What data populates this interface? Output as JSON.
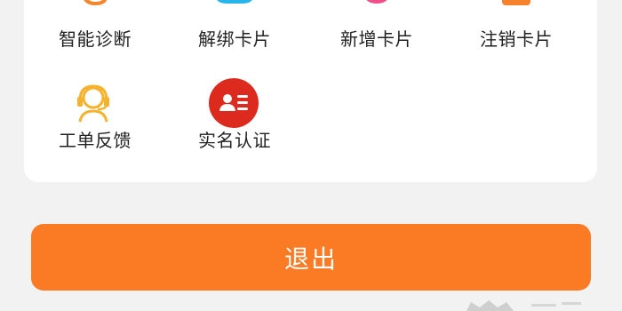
{
  "services": {
    "row1": [
      {
        "label": "智能诊断",
        "icon": "diagnose-icon",
        "color": "#f3862b"
      },
      {
        "label": "解绑卡片",
        "icon": "unbind-card-icon",
        "color": "#2ab4ec"
      },
      {
        "label": "新增卡片",
        "icon": "add-card-icon",
        "color": "#ef4d8a"
      },
      {
        "label": "注销卡片",
        "icon": "cancel-card-icon",
        "color": "#f6822d"
      }
    ],
    "row2": [
      {
        "label": "工单反馈",
        "icon": "customer-service-icon",
        "color": "#f5b22c"
      },
      {
        "label": "实名认证",
        "icon": "id-card-icon",
        "color": "#dd2a1e"
      }
    ]
  },
  "logout": {
    "label": "退出",
    "color": "#fb7b25"
  }
}
